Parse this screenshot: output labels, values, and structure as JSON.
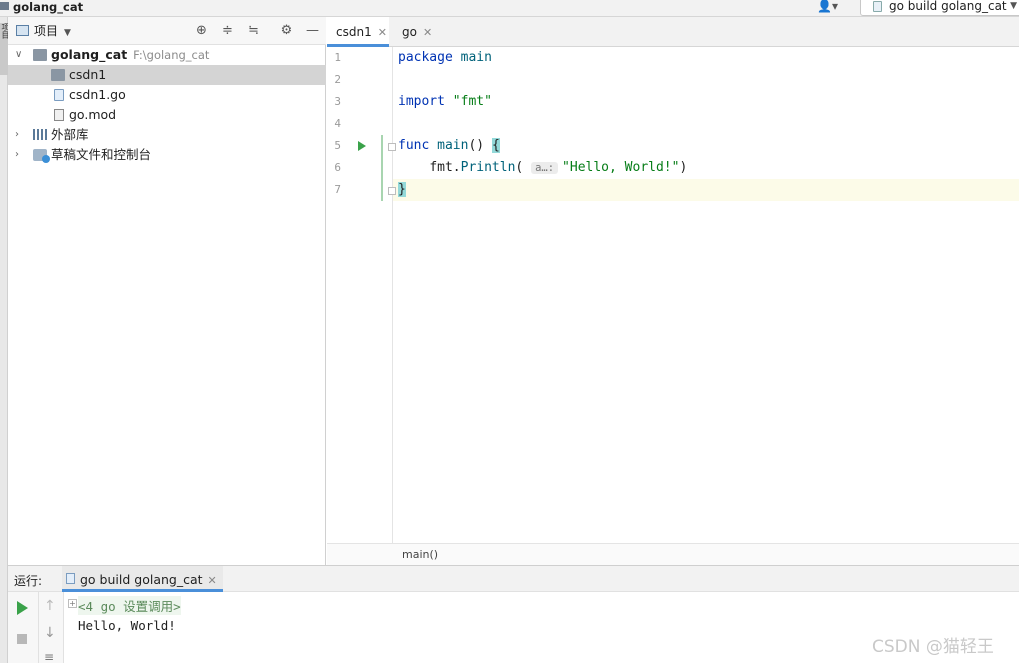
{
  "top": {
    "project": "golang_cat",
    "user_icon": "user-icon",
    "run_config": "go build golang_cat"
  },
  "left_strip": {
    "tab_label": "项目"
  },
  "project_panel": {
    "title": "项目",
    "tree": [
      {
        "label": "golang_cat",
        "hint": "F:\\golang_cat",
        "kind": "folder",
        "expanded": true
      },
      {
        "label": "csdn1",
        "kind": "folder",
        "selected": true
      },
      {
        "label": "csdn1.go",
        "kind": "go-file"
      },
      {
        "label": "go.mod",
        "kind": "mod-file"
      },
      {
        "label": "外部库",
        "kind": "library"
      },
      {
        "label": "草稿文件和控制台",
        "kind": "scratches"
      }
    ]
  },
  "editor": {
    "tabs": [
      {
        "label": "csdn1",
        "active": true
      },
      {
        "label": "go",
        "active": false
      }
    ],
    "line_numbers": [
      "1",
      "2",
      "3",
      "4",
      "5",
      "6",
      "7"
    ],
    "code": {
      "l1_kw": "package",
      "l1_name": "main",
      "l3_kw": "import",
      "l3_str": "\"fmt\"",
      "l5_kw": "func",
      "l5_fn": "main",
      "l5_paren": "() ",
      "l5_brace": "{",
      "l6_pkg": "fmt.",
      "l6_fn": "Println",
      "l6_open": "(",
      "l6_hint": "a…:",
      "l6_str": "\"Hello, World!\"",
      "l6_close": ")",
      "l7_brace": "}"
    },
    "breadcrumb": "main()"
  },
  "run_panel": {
    "label": "运行:",
    "tab": "go build golang_cat",
    "output": [
      "<4 go 设置调用>",
      "Hello, World!"
    ]
  },
  "watermark": "CSDN @猫轻王"
}
